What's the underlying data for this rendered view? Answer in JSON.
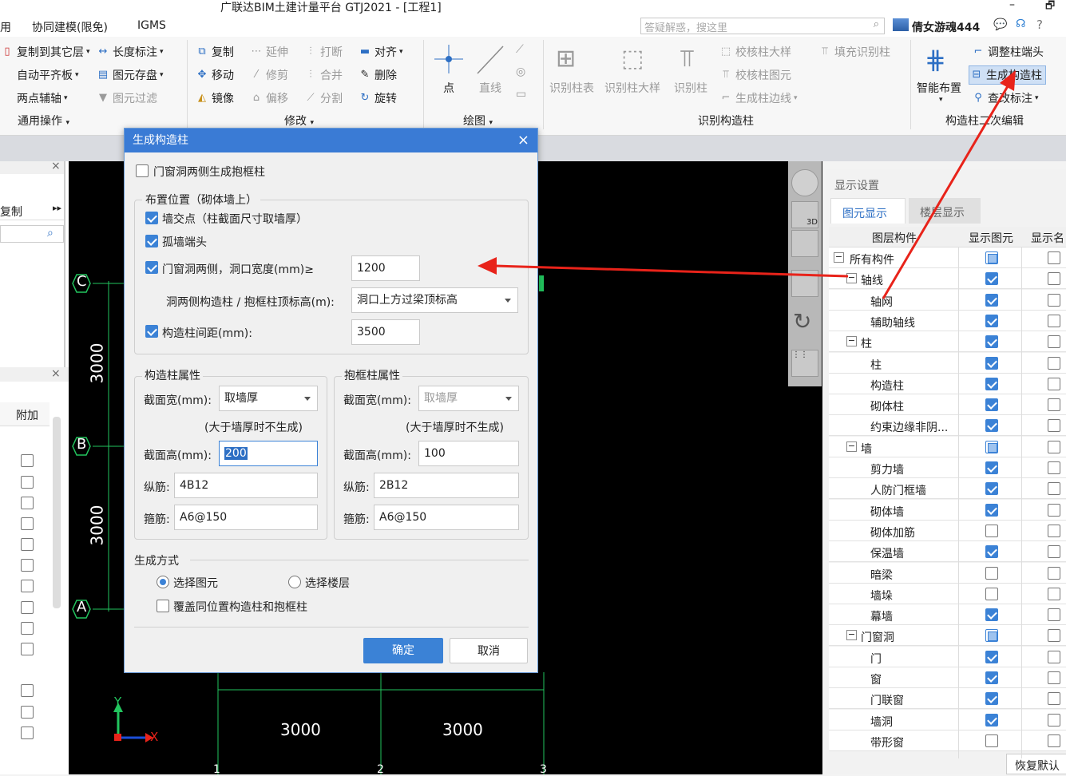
{
  "window": {
    "title": "广联达BIM土建计量平台 GTJ2021 - [工程1]",
    "min": "–",
    "restore": "🗗"
  },
  "menu": {
    "item0": "用",
    "item1": "协同建模(限免)",
    "item2": "IGMS",
    "search_placeholder": "答疑解惑，搜这里",
    "user": "倩女游魂444",
    "help": "?"
  },
  "ribbon": {
    "general": {
      "copy_to_floor": "复制到其它层",
      "length_dim": "长度标注",
      "auto_slab": "自动平齐板",
      "save_element": "图元存盘",
      "two_point_axis": "两点辅轴",
      "filter": "图元过滤",
      "label": "通用操作"
    },
    "modify": {
      "copy": "复制",
      "extend": "延伸",
      "break": "打断",
      "align": "对齐",
      "move": "移动",
      "trim": "修剪",
      "merge": "合并",
      "delete": "删除",
      "mirror": "镜像",
      "offset": "偏移",
      "split": "分割",
      "rotate": "旋转",
      "label": "修改"
    },
    "draw": {
      "point": "点",
      "line": "直线",
      "label": "绘图"
    },
    "recognize": {
      "col_table": "识别柱表",
      "col_detail": "识别柱大样",
      "col": "识别柱",
      "check_detail": "校核柱大样",
      "check_elem": "校核柱图元",
      "gen_edge": "生成柱边线",
      "fill_col": "填充识别柱",
      "label": "识别构造柱"
    },
    "edit": {
      "adjust_end": "调整柱端头",
      "smart_layout": "智能布置",
      "gen_struct_col": "生成构造柱",
      "edit_label": "查改标注",
      "label": "构造柱二次编辑"
    }
  },
  "left": {
    "copy": "复制",
    "attach": "附加"
  },
  "canvas": {
    "axis_c": "C",
    "axis_b": "B",
    "axis_a": "A",
    "dim_v1": "3000",
    "dim_v2": "3000",
    "dim_h1": "3000",
    "dim_h2": "3000",
    "y": "Y",
    "x": "X",
    "bottom1": "1",
    "bottom2": "2",
    "bottom3": "3"
  },
  "dialog": {
    "title": "生成构造柱",
    "close": "×",
    "frame_both_sides": "门窗洞两侧生成抱框柱",
    "position_legend": "布置位置（砌体墙上）",
    "wall_intersection": "墙交点（柱截面尺寸取墙厚）",
    "isolated_wall_end": "孤墙端头",
    "opening_sides": "门窗洞两侧，洞口宽度(mm)≥",
    "opening_width": "1200",
    "top_elev_label": "洞两侧构造柱 / 抱框柱顶标高(m):",
    "top_elev_value": "洞口上方过梁顶标高",
    "spacing_label": "构造柱间距(mm):",
    "spacing_value": "3500",
    "struct_legend": "构造柱属性",
    "frame_legend": "抱框柱属性",
    "width_label": "截面宽(mm):",
    "struct_width": "取墙厚",
    "frame_width": "取墙厚",
    "hint": "(大于墙厚时不生成)",
    "height_label": "截面高(mm):",
    "struct_height": "200",
    "frame_height": "100",
    "long_bar_label": "纵筋:",
    "struct_long": "4B12",
    "frame_long": "2B12",
    "stirrup_label": "箍筋:",
    "struct_stirrup": "A6@150",
    "frame_stirrup": "A6@150",
    "method_legend": "生成方式",
    "select_elem": "选择图元",
    "select_floor": "选择楼层",
    "overwrite": "覆盖同位置构造柱和抱框柱",
    "ok": "确定",
    "cancel": "取消"
  },
  "display": {
    "title": "显示设置",
    "tab1": "图元显示",
    "tab2": "楼层显示",
    "col1": "图层构件",
    "col2": "显示图元",
    "col3": "显示名",
    "restore": "恢复默认",
    "rows": [
      {
        "name": "所有构件",
        "level": 0,
        "toggle": "−",
        "state": "part"
      },
      {
        "name": "轴线",
        "level": 1,
        "toggle": "−",
        "state": "on"
      },
      {
        "name": "轴网",
        "level": 2,
        "state": "on"
      },
      {
        "name": "辅助轴线",
        "level": 2,
        "state": "on"
      },
      {
        "name": "柱",
        "level": 1,
        "toggle": "−",
        "state": "on"
      },
      {
        "name": "柱",
        "level": 2,
        "state": "on"
      },
      {
        "name": "构造柱",
        "level": 2,
        "state": "on"
      },
      {
        "name": "砌体柱",
        "level": 2,
        "state": "on"
      },
      {
        "name": "约束边缘非阴...",
        "level": 2,
        "state": "on"
      },
      {
        "name": "墙",
        "level": 1,
        "toggle": "−",
        "state": "part"
      },
      {
        "name": "剪力墙",
        "level": 2,
        "state": "on"
      },
      {
        "name": "人防门框墙",
        "level": 2,
        "state": "on"
      },
      {
        "name": "砌体墙",
        "level": 2,
        "state": "on"
      },
      {
        "name": "砌体加筋",
        "level": 2,
        "state": "off"
      },
      {
        "name": "保温墙",
        "level": 2,
        "state": "on"
      },
      {
        "name": "暗梁",
        "level": 2,
        "state": "off"
      },
      {
        "name": "墙垛",
        "level": 2,
        "state": "off"
      },
      {
        "name": "幕墙",
        "level": 2,
        "state": "on"
      },
      {
        "name": "门窗洞",
        "level": 1,
        "toggle": "−",
        "state": "part"
      },
      {
        "name": "门",
        "level": 2,
        "state": "on"
      },
      {
        "name": "窗",
        "level": 2,
        "state": "on"
      },
      {
        "name": "门联窗",
        "level": 2,
        "state": "on"
      },
      {
        "name": "墙洞",
        "level": 2,
        "state": "on"
      },
      {
        "name": "带形窗",
        "level": 2,
        "state": "off"
      }
    ]
  },
  "colors": {
    "accent": "#3b82d6",
    "axis_green": "#22c55e",
    "arrow_red": "#e8231a",
    "dialog_title": "#3a7bd5"
  }
}
